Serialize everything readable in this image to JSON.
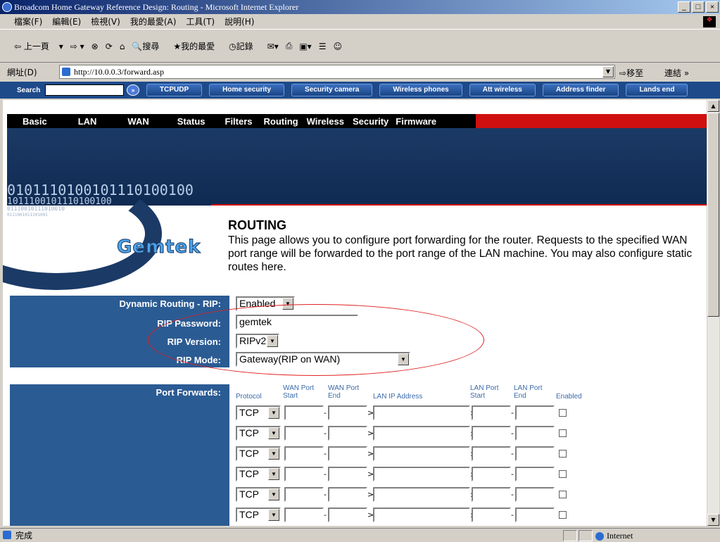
{
  "window": {
    "title": "Broadcom Home Gateway Reference Design: Routing - Microsoft Internet Explorer",
    "buttons": [
      "_",
      "□",
      "×"
    ]
  },
  "menu": [
    "檔案(F)",
    "編輯(E)",
    "檢視(V)",
    "我的最愛(A)",
    "工具(T)",
    "說明(H)"
  ],
  "toolbar": {
    "back": "上一頁",
    "search": "搜尋",
    "favorites": "我的最愛",
    "history": "記錄"
  },
  "address": {
    "label": "網址(D)",
    "url": "http://10.0.0.3/forward.asp",
    "go": "移至",
    "links": "連結"
  },
  "searchbar": {
    "label": "Search",
    "buttons": [
      "TCPUDP",
      "Home security",
      "Security camera",
      "Wireless phones",
      "Att wireless",
      "Address finder",
      "Lands end"
    ]
  },
  "nav": [
    "Basic",
    "LAN",
    "WAN",
    "Status",
    "Filters",
    "Routing",
    "Wireless",
    "Security",
    "Firmware"
  ],
  "banner": {
    "bits1": "0101110100101110100100",
    "bits2": "1011100101110100100",
    "bits3": "01110010111010010",
    "bits4": "0111001011101001"
  },
  "logo": "Gemtek",
  "page": {
    "title": "ROUTING",
    "description": "This page allows you to configure port forwarding for the router. Requests to the specified WAN port range will be forwarded to the port range of the LAN machine. You may also configure static routes here."
  },
  "rip": {
    "routing_label": "Dynamic Routing - RIP:",
    "routing_value": "Enabled",
    "password_label": "RIP Password:",
    "password_value": "gemtek",
    "version_label": "RIP Version:",
    "version_value": "RIPv2",
    "mode_label": "RIP Mode:",
    "mode_value": "Gateway(RIP on WAN)"
  },
  "port_forwards": {
    "label": "Port Forwards:",
    "columns": [
      "Protocol",
      "WAN Port Start",
      "WAN Port End",
      "LAN IP Address",
      "LAN Port Start",
      "LAN Port End",
      "Enabled"
    ],
    "rows": [
      {
        "protocol": "TCP",
        "separator1": "-",
        "separator2": ">",
        "separator3": ":",
        "separator4": "-"
      },
      {
        "protocol": "TCP",
        "separator1": "-",
        "separator2": ">",
        "separator3": ":",
        "separator4": "-"
      },
      {
        "protocol": "TCP",
        "separator1": "-",
        "separator2": ">",
        "separator3": ":",
        "separator4": "-"
      },
      {
        "protocol": "TCP",
        "separator1": "-",
        "separator2": ">",
        "separator3": ":",
        "separator4": "-"
      },
      {
        "protocol": "TCP",
        "separator1": "-",
        "separator2": ">",
        "separator3": ":",
        "separator4": "-"
      },
      {
        "protocol": "TCP",
        "separator1": "-",
        "separator2": ">",
        "separator3": ":",
        "separator4": "-"
      }
    ]
  },
  "status": {
    "text": "完成",
    "zone": "Internet"
  }
}
